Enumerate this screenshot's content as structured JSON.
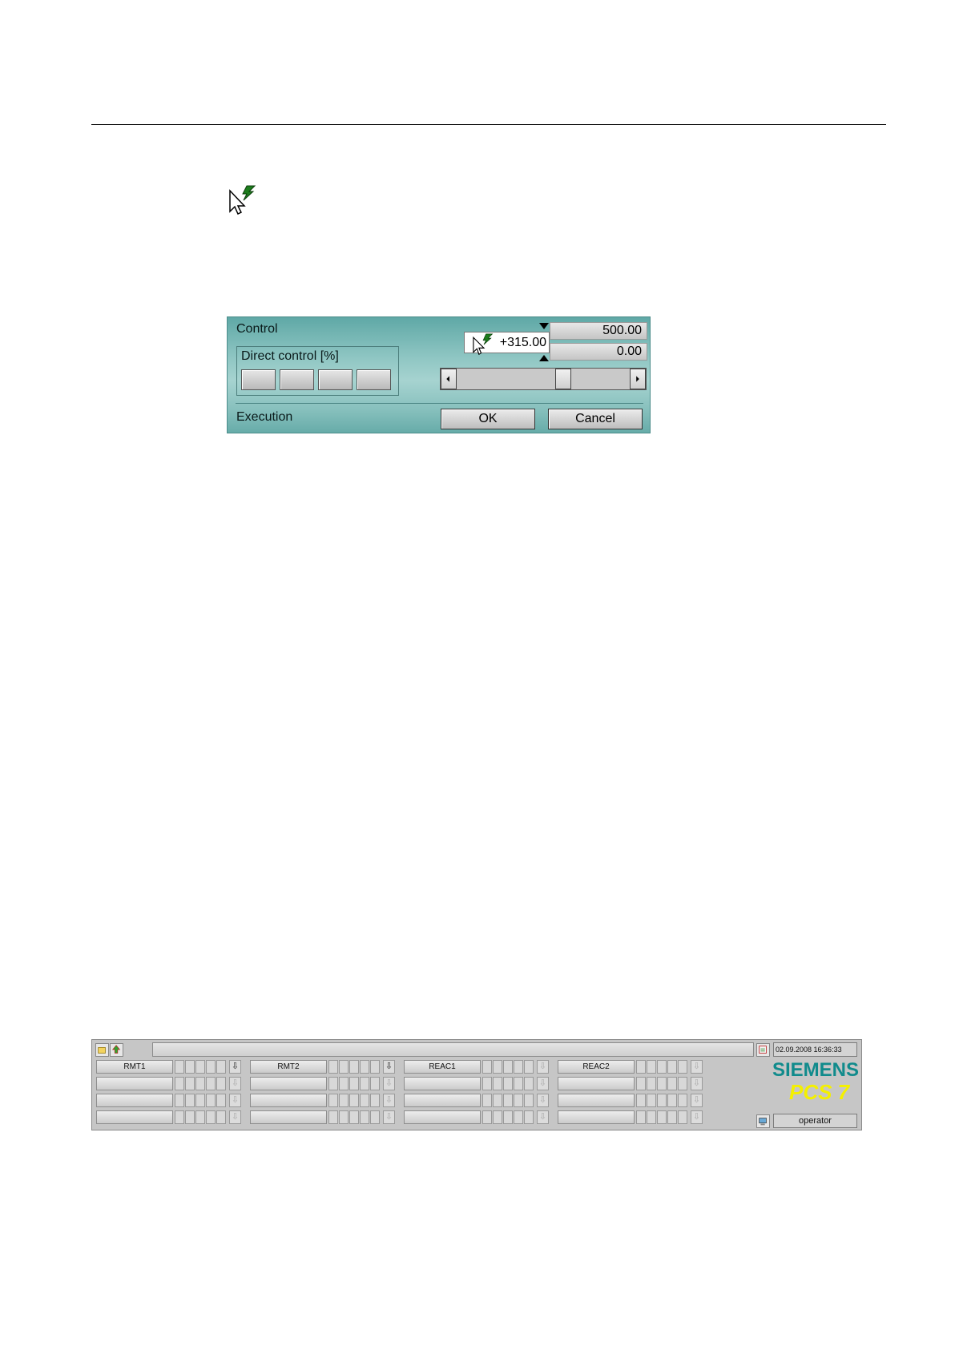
{
  "dialog": {
    "control_label": "Control",
    "direct_control_label": "Direct control [%]",
    "high_limit": "500.00",
    "low_limit": "0.00",
    "input_value": "+315.00",
    "execution_label": "Execution",
    "ok_label": "OK",
    "cancel_label": "Cancel",
    "slider_level_fraction": 0.63
  },
  "overview": {
    "datetime": "02.09.2008 16:36:33",
    "areas": [
      "RMT1",
      "RMT2",
      "REAC1",
      "REAC2"
    ],
    "logo_brand": "SIEMENS",
    "logo_product": "PCS 7",
    "user": "operator"
  },
  "colors": {
    "dialog_accent": "#8fc6c3",
    "brand_teal": "#108b8c",
    "pcs7_yellow": "#f4f000"
  }
}
